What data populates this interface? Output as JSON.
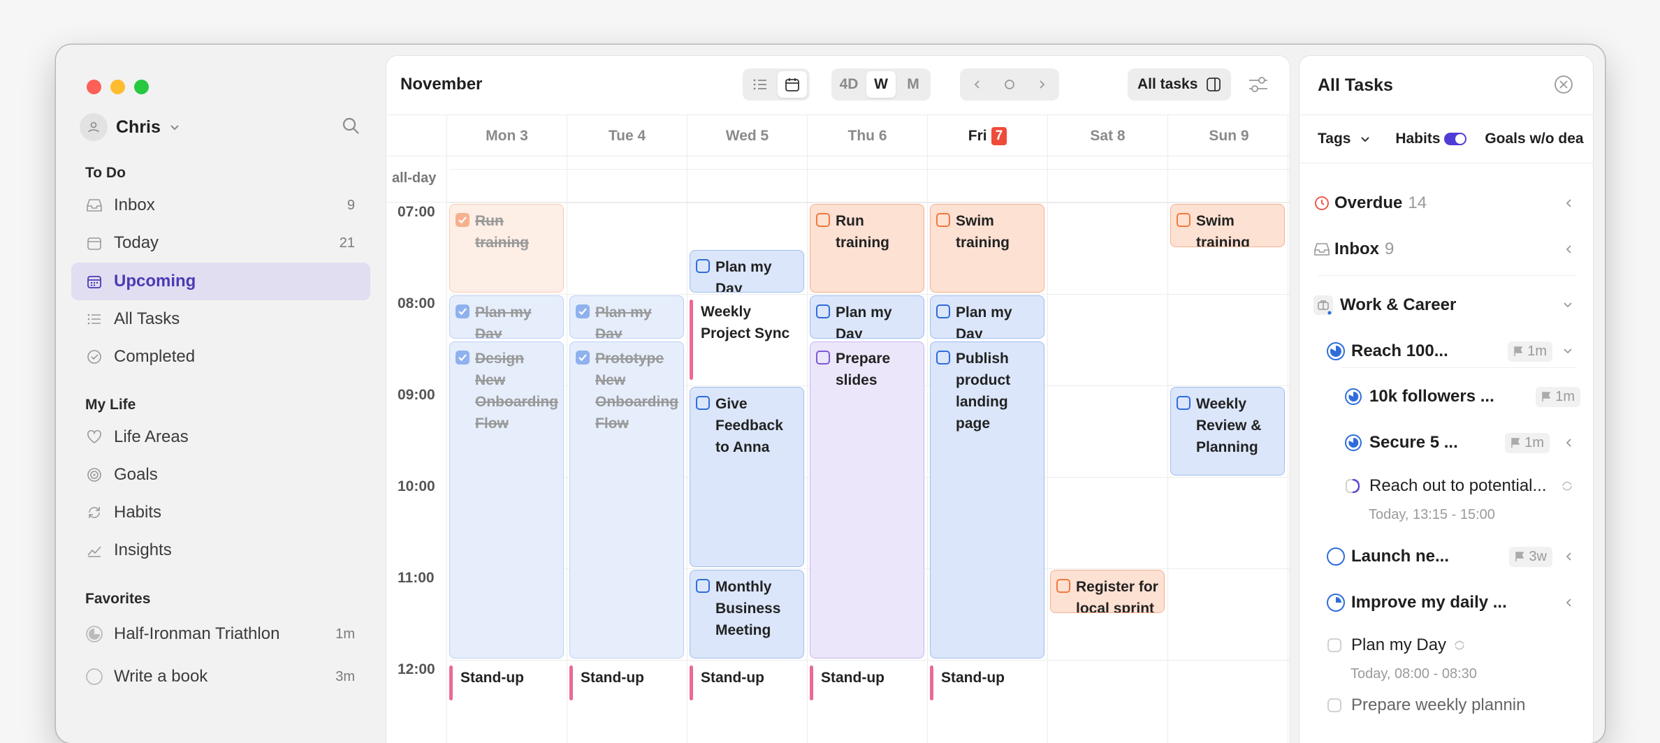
{
  "user": {
    "name": "Chris"
  },
  "sidebar": {
    "todo_title": "To Do",
    "todo": [
      {
        "label": "Inbox",
        "count": "9"
      },
      {
        "label": "Today",
        "count": "21"
      },
      {
        "label": "Upcoming",
        "count": ""
      },
      {
        "label": "All Tasks",
        "count": ""
      },
      {
        "label": "Completed",
        "count": ""
      }
    ],
    "mylife_title": "My Life",
    "mylife": [
      {
        "label": "Life Areas"
      },
      {
        "label": "Goals"
      },
      {
        "label": "Habits"
      },
      {
        "label": "Insights"
      }
    ],
    "fav_title": "Favorites",
    "favorites": [
      {
        "label": "Half-Ironman Triathlon",
        "age": "1m"
      },
      {
        "label": "Write a book",
        "age": "3m"
      }
    ]
  },
  "calendar": {
    "month": "November",
    "views": [
      "4D",
      "W",
      "M"
    ],
    "selected_view": "W",
    "all_tasks": "All tasks",
    "days": [
      "Mon 3",
      "Tue 4",
      "Wed 5",
      "Thu 6",
      "Fri",
      "Sat 8",
      "Sun 9"
    ],
    "today_num": "7",
    "allday_label": "all-day",
    "times": [
      "07:00",
      "08:00",
      "09:00",
      "10:00",
      "11:00",
      "12:00"
    ],
    "events": [
      {
        "title": "Run training",
        "day": 0,
        "start": "07:00",
        "end": "08:00",
        "color": "orange",
        "done": true
      },
      {
        "title": "Plan my Day",
        "day": 0,
        "start": "08:00",
        "end": "08:30",
        "color": "blue",
        "done": true
      },
      {
        "title": "Design New Onboarding Flow",
        "day": 0,
        "start": "08:30",
        "end": "12:00",
        "color": "blue",
        "done": true
      },
      {
        "title": "Plan my Day",
        "day": 1,
        "start": "08:00",
        "end": "08:30",
        "color": "blue",
        "done": true
      },
      {
        "title": "Prototype New Onboarding Flow",
        "day": 1,
        "start": "08:30",
        "end": "12:00",
        "color": "blue",
        "done": true
      },
      {
        "title": "Plan my Day",
        "day": 2,
        "start": "07:30",
        "end": "08:00",
        "color": "blue",
        "done": false
      },
      {
        "title": "Weekly Project Sync",
        "day": 2,
        "start": "08:00",
        "end": "09:00",
        "color": "meet",
        "done": false
      },
      {
        "title": "Give Feedback to Anna",
        "day": 2,
        "start": "09:00",
        "end": "11:00",
        "color": "blue",
        "done": false
      },
      {
        "title": "Monthly Business Meeting",
        "day": 2,
        "start": "11:00",
        "end": "12:00",
        "color": "blue",
        "done": false
      },
      {
        "title": "Run training",
        "day": 3,
        "start": "07:00",
        "end": "08:00",
        "color": "orange",
        "done": false
      },
      {
        "title": "Plan my Day",
        "day": 3,
        "start": "08:00",
        "end": "08:30",
        "color": "blue",
        "done": false
      },
      {
        "title": "Prepare slides",
        "day": 3,
        "start": "08:30",
        "end": "12:00",
        "color": "purple",
        "done": false
      },
      {
        "title": "Swim training",
        "day": 4,
        "start": "07:00",
        "end": "08:00",
        "color": "orange",
        "done": false
      },
      {
        "title": "Plan my Day",
        "day": 4,
        "start": "08:00",
        "end": "08:30",
        "color": "blue",
        "done": false
      },
      {
        "title": "Publish product landing page",
        "day": 4,
        "start": "08:30",
        "end": "12:00",
        "color": "blue",
        "done": false
      },
      {
        "title": "Register for local sprint",
        "day": 5,
        "start": "11:00",
        "end": "11:30",
        "color": "orange",
        "done": false
      },
      {
        "title": "Swim training",
        "day": 6,
        "start": "07:00",
        "end": "07:30",
        "color": "orange",
        "done": false
      },
      {
        "title": "Weekly Review & Planning",
        "day": 6,
        "start": "09:00",
        "end": "10:00",
        "color": "blue",
        "done": false
      },
      {
        "title": "Stand-up",
        "day": 0,
        "start": "12:00",
        "end": "12:30",
        "color": "meet",
        "done": false
      },
      {
        "title": "Stand-up",
        "day": 1,
        "start": "12:00",
        "end": "12:30",
        "color": "meet",
        "done": false
      },
      {
        "title": "Stand-up",
        "day": 2,
        "start": "12:00",
        "end": "12:30",
        "color": "meet",
        "done": false
      },
      {
        "title": "Stand-up",
        "day": 3,
        "start": "12:00",
        "end": "12:30",
        "color": "meet",
        "done": false
      },
      {
        "title": "Stand-up",
        "day": 4,
        "start": "12:00",
        "end": "12:30",
        "color": "meet",
        "done": false
      }
    ]
  },
  "panel": {
    "title": "All Tasks",
    "tabs": {
      "tags": "Tags",
      "habits": "Habits",
      "goals": "Goals w/o dea"
    },
    "overdue": {
      "label": "Overdue",
      "count": "14"
    },
    "inbox": {
      "label": "Inbox",
      "count": "9"
    },
    "area": "Work & Career",
    "goal1": {
      "label": "Reach 100...",
      "age": "1m"
    },
    "goal1a": {
      "label": "10k followers ...",
      "age": "1m"
    },
    "goal1b": {
      "label": "Secure 5 ...",
      "age": "1m"
    },
    "task1": {
      "label": "Reach out to potential...",
      "time": "Today, 13:15 - 15:00"
    },
    "goal2": {
      "label": "Launch ne...",
      "age": "3w"
    },
    "goal3": {
      "label": "Improve my daily ..."
    },
    "task2": {
      "label": "Plan my Day",
      "time": "Today, 08:00 - 08:30"
    },
    "task3": {
      "label": "Prepare weekly plannin"
    }
  }
}
